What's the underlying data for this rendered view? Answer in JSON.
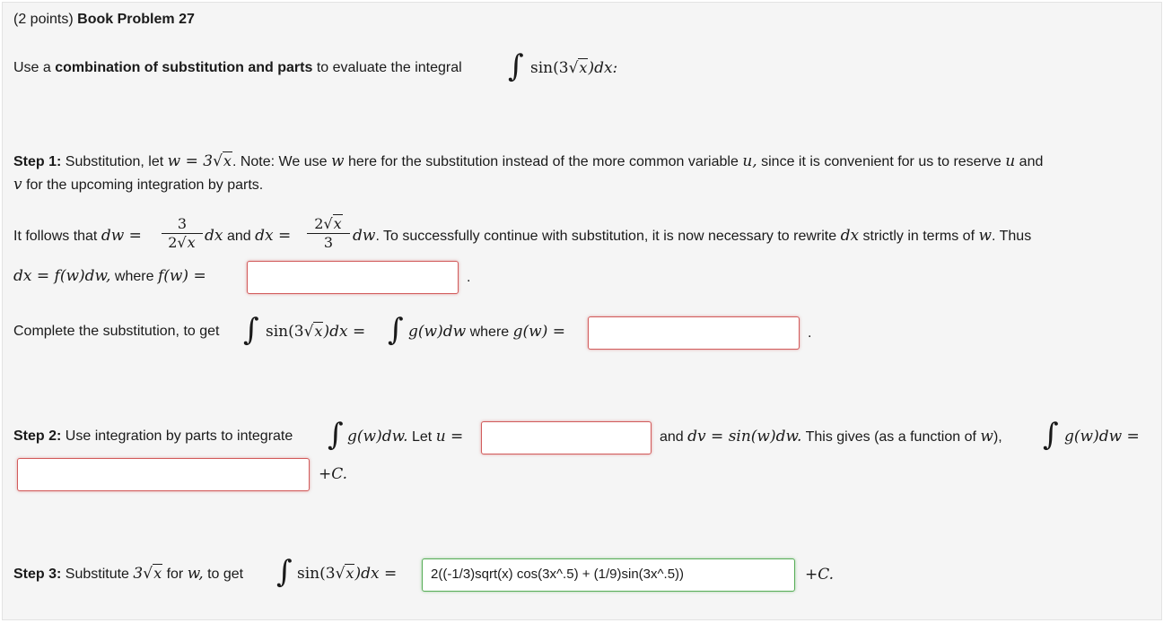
{
  "header": {
    "points": "(2 points)",
    "title": "Book Problem 27"
  },
  "intro": {
    "prefix": "Use a",
    "bold": "combination of substitution and parts",
    "suffix": "to evaluate the integral",
    "integrand_func": "sin(3",
    "integrand_rad": "x",
    "integrand_end": ")dx:"
  },
  "step1": {
    "label": "Step 1:",
    "text_a": "Substitution, let",
    "let_w": "w = 3",
    "rad_x": "x",
    "text_b": ". Note: We use",
    "var_w": "w",
    "text_c": "here for the substitution instead of the more common variable",
    "var_u": "u,",
    "text_d": "since it is convenient for us to reserve",
    "var_u2": "u",
    "text_e": "and",
    "line2_v": "v",
    "line2_text": "for the upcoming integration by parts.",
    "follows": "It follows that",
    "dw_eq": "dw =",
    "frac1_num": "3",
    "frac1_den_coef": "2",
    "frac1_den_rad": "x",
    "dx_and": "dx",
    "and_word": "and",
    "dx_eq": "dx =",
    "frac2_num_coef": "2",
    "frac2_num_rad": "x",
    "frac2_den": "3",
    "dw_tail": "dw",
    "tail_text": ". To successfully continue with substitution, it is now necessary to rewrite",
    "dx_word": "dx",
    "tail_text2": "strictly in terms of",
    "w_word": "w",
    "thus": ". Thus",
    "fw_lhs": "dx = f(w)dw,",
    "where": "where",
    "fw": "f(w) =",
    "period": ".",
    "complete_text": "Complete the substitution, to get",
    "lhs_func": "sin(3",
    "lhs_rad": "x",
    "lhs_end": ")dx =",
    "gw_dw": "g(w)dw",
    "where2": "where",
    "gw_eq": "g(w) ="
  },
  "step2": {
    "label": "Step 2:",
    "text": "Use integration by parts to integrate",
    "gw_dw": "g(w)dw.",
    "let": "Let",
    "u_eq": "u =",
    "and": "and",
    "dv": "dv = sin(w)dw.",
    "gives": "This gives (as a function of",
    "w": "w",
    "gives_end": "),",
    "gw_dw2": "g(w)dw =",
    "plus_c": "+C."
  },
  "step3": {
    "label": "Step 3:",
    "text_a": "Substitute",
    "sub_expr": "3",
    "sub_rad": "x",
    "for_word": "for",
    "w": "w,",
    "to_get": "to get",
    "func": "sin(3",
    "rad": "x",
    "end": ")dx =",
    "answer": "2((-1/3)sqrt(x) cos(3x^.5) + (1/9)sin(3x^.5))",
    "plus_c": "+C."
  },
  "colors": {
    "panel_bg": "#f5f5f5",
    "incorrect_border": "#d25b5b",
    "correct_border": "#58ae58"
  }
}
